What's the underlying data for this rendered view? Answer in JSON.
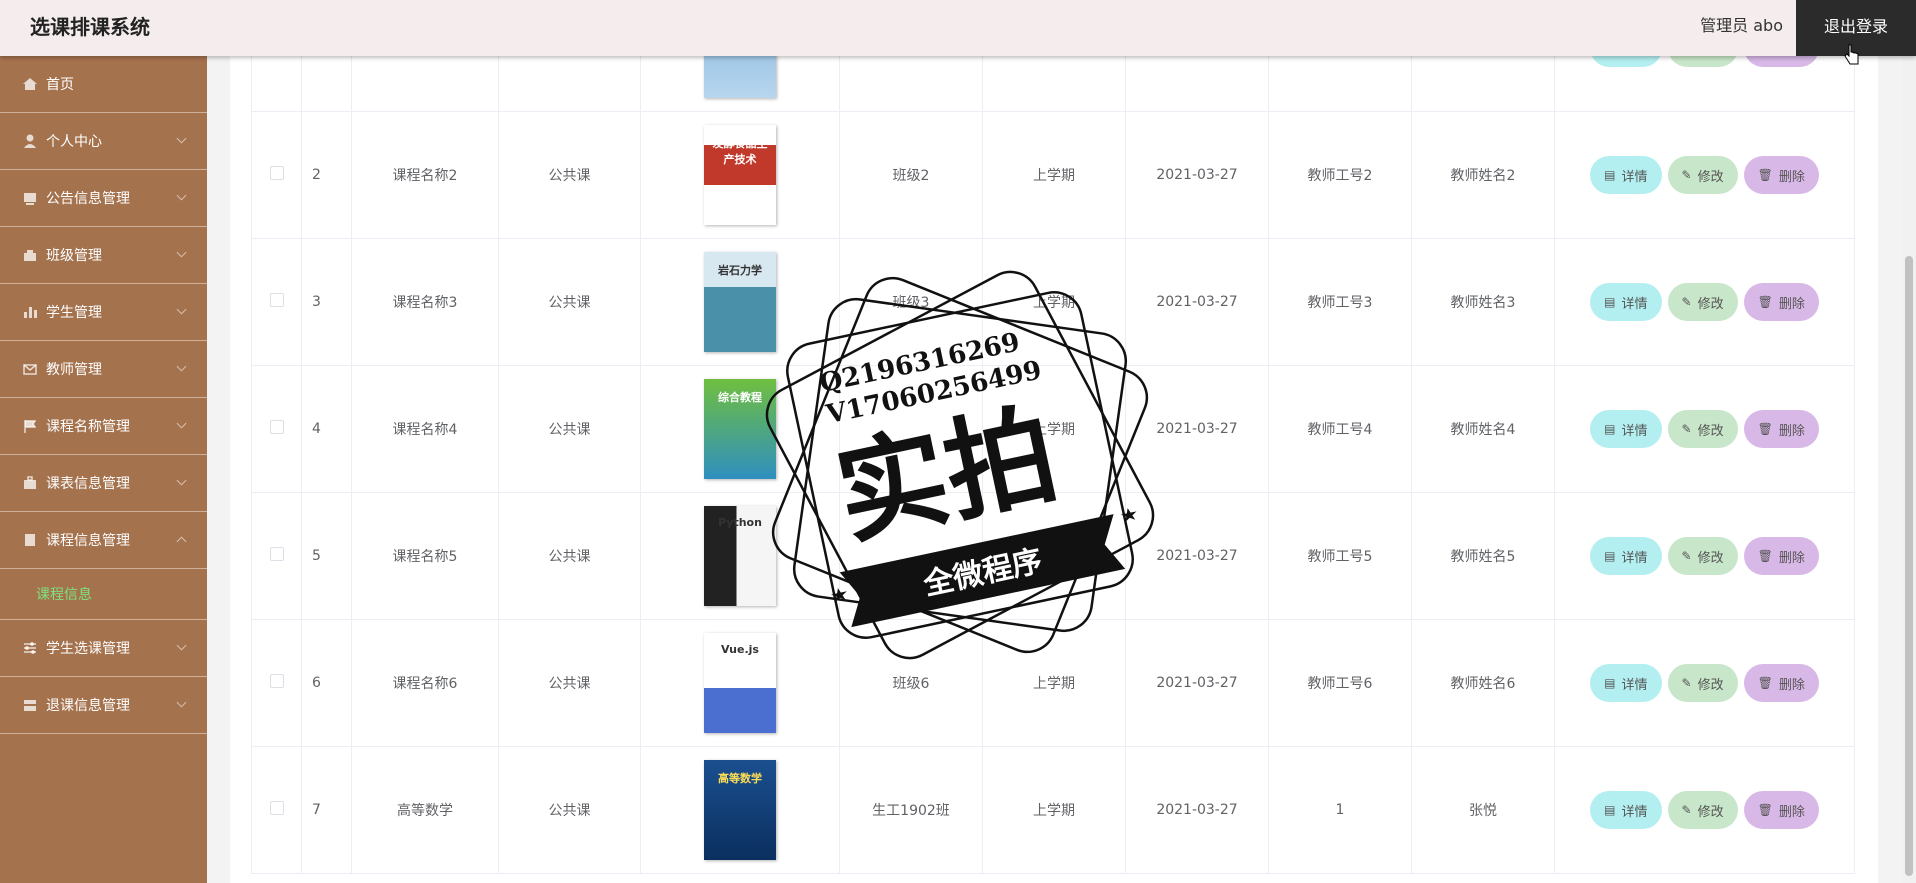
{
  "header": {
    "app_title": "选课排课系统",
    "admin_label": "管理员 abo",
    "logout_label": "退出登录"
  },
  "sidebar": {
    "items": [
      {
        "label": "首页",
        "icon": "home-icon",
        "name": "home"
      },
      {
        "label": "个人中心",
        "icon": "user-icon",
        "name": "personal-center"
      },
      {
        "label": "公告信息管理",
        "icon": "notice-icon",
        "name": "notice-management"
      },
      {
        "label": "班级管理",
        "icon": "class-icon",
        "name": "class-management"
      },
      {
        "label": "学生管理",
        "icon": "chart-icon",
        "name": "student-management"
      },
      {
        "label": "教师管理",
        "icon": "mail-icon",
        "name": "teacher-management"
      },
      {
        "label": "课程名称管理",
        "icon": "flag-icon",
        "name": "course-name-management"
      },
      {
        "label": "课表信息管理",
        "icon": "briefcase-icon",
        "name": "timetable-management"
      },
      {
        "label": "课程信息管理",
        "icon": "doc-icon",
        "name": "course-info-management",
        "expanded": true
      }
    ],
    "sub_item": "课程信息",
    "items_after": [
      {
        "label": "学生选课管理",
        "icon": "sliders-icon",
        "name": "student-selection-management"
      },
      {
        "label": "退课信息管理",
        "icon": "drop-icon",
        "name": "withdraw-management"
      }
    ]
  },
  "table": {
    "rows": [
      {
        "index": "",
        "course_name": "",
        "course_type": "",
        "cover": "blue",
        "cover_text": "",
        "class_name": "",
        "term": "",
        "date": "",
        "teacher_id": "",
        "teacher_name": ""
      },
      {
        "index": "2",
        "course_name": "课程名称2",
        "course_type": "公共课",
        "cover": "red",
        "cover_text": "发酵食品生产技术",
        "class_name": "班级2",
        "term": "上学期",
        "date": "2021-03-27",
        "teacher_id": "教师工号2",
        "teacher_name": "教师姓名2"
      },
      {
        "index": "3",
        "course_name": "课程名称3",
        "course_type": "公共课",
        "cover": "teal",
        "cover_text": "岩石力学",
        "class_name": "班级3",
        "term": "上学期",
        "date": "2021-03-27",
        "teacher_id": "教师工号3",
        "teacher_name": "教师姓名3"
      },
      {
        "index": "4",
        "course_name": "课程名称4",
        "course_type": "公共课",
        "cover": "green",
        "cover_text": "综合教程",
        "class_name": "",
        "term": "上学期",
        "date": "2021-03-27",
        "teacher_id": "教师工号4",
        "teacher_name": "教师姓名4"
      },
      {
        "index": "5",
        "course_name": "课程名称5",
        "course_type": "公共课",
        "cover": "dark",
        "cover_text": "Python",
        "class_name": "",
        "term": "",
        "date": "2021-03-27",
        "teacher_id": "教师工号5",
        "teacher_name": "教师姓名5"
      },
      {
        "index": "6",
        "course_name": "课程名称6",
        "course_type": "公共课",
        "cover": "white",
        "cover_text": "Vue.js",
        "class_name": "班级6",
        "term": "上学期",
        "date": "2021-03-27",
        "teacher_id": "教师工号6",
        "teacher_name": "教师姓名6"
      },
      {
        "index": "7",
        "course_name": "高等数学",
        "course_type": "公共课",
        "cover": "navy",
        "cover_text": "高等数学",
        "class_name": "生工1902班",
        "term": "上学期",
        "date": "2021-03-27",
        "teacher_id": "1",
        "teacher_name": "张悦"
      }
    ],
    "actions": {
      "detail": "详情",
      "edit": "修改",
      "delete": "删除"
    }
  },
  "stamp": {
    "line1": "Q2196316269",
    "line2": "V17060256499",
    "big": "实拍",
    "banner": "全微程序"
  }
}
